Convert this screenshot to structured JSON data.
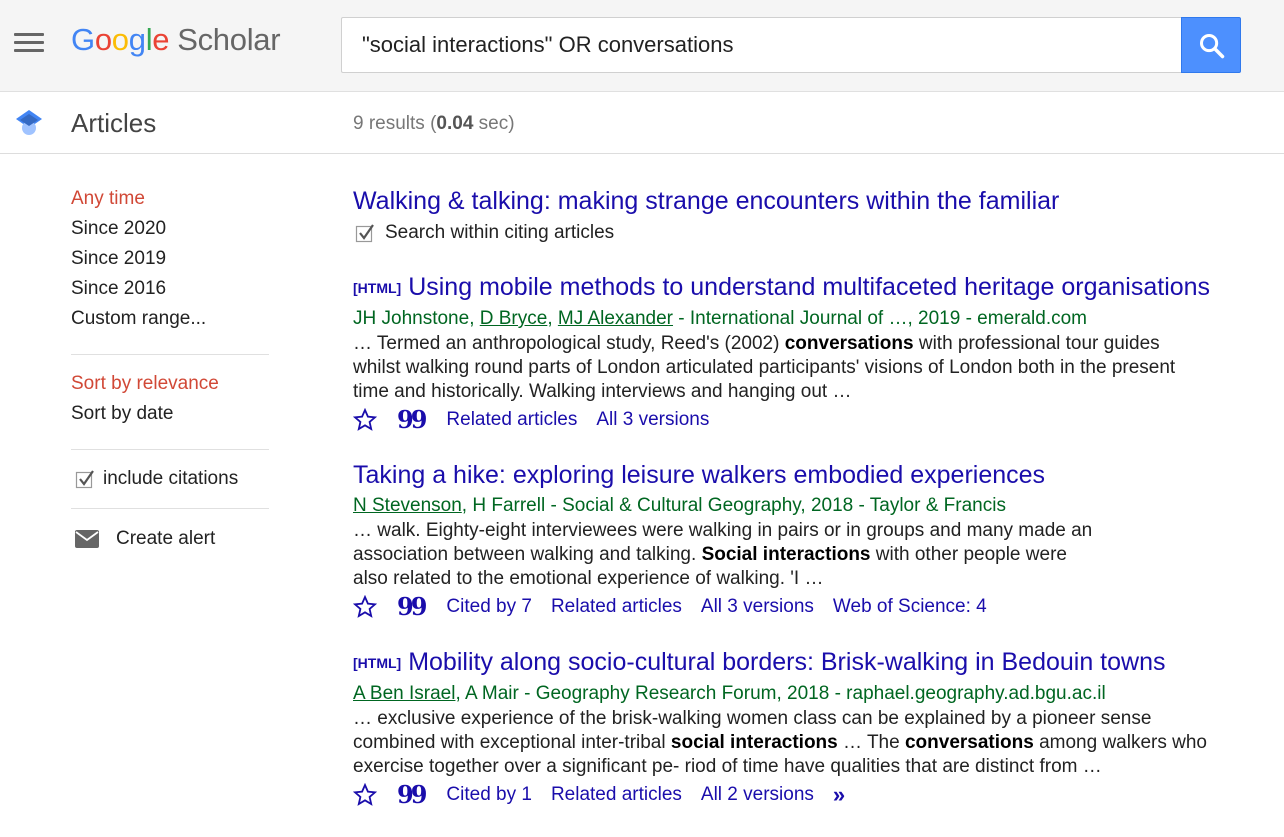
{
  "header": {
    "logo": {
      "google": [
        "G",
        "o",
        "o",
        "g",
        "l",
        "e"
      ],
      "product": "Scholar"
    },
    "search": {
      "value": "\"social interactions\" OR conversations",
      "placeholder": ""
    },
    "menu_icon": "hamburger-menu-icon",
    "search_icon": "search-icon"
  },
  "subheader": {
    "section_icon": "graduation-cap-icon",
    "section_label": "Articles",
    "results_prefix": "9 results (",
    "results_time": "0.04",
    "results_suffix": " sec)"
  },
  "sidebar": {
    "time_filters": [
      "Any time",
      "Since 2020",
      "Since 2019",
      "Since 2016",
      "Custom range..."
    ],
    "time_active_index": 0,
    "sort_options": [
      "Sort by relevance",
      "Sort by date"
    ],
    "sort_active_index": 0,
    "include_citations": {
      "label": "include citations",
      "checked": true
    },
    "create_alert": {
      "label": "Create alert",
      "icon": "envelope-icon"
    }
  },
  "results": {
    "r0": {
      "title": "Walking & talking: making strange encounters within the familiar",
      "citing_label": "Search within citing articles"
    },
    "r1": {
      "tag": "[HTML]",
      "title": "Using mobile methods to understand multifaceted heritage organisations",
      "meta": {
        "a1": "JH Johnstone",
        "sep1": ", ",
        "a2": "D Bryce",
        "sep2": ", ",
        "a3": "MJ Alexander",
        "rest": " - International Journal of …, 2019 - emerald.com"
      },
      "snippet": {
        "p1": "… Termed an anthropological study, Reed's (2002) ",
        "b1": "conversations",
        "p2": " with professional tour guides whilst walking round parts of London articulated participants' visions of London both in the present time and historically. Walking interviews and hanging out …"
      },
      "actions": {
        "related": "Related articles",
        "versions": "All 3 versions"
      }
    },
    "r2": {
      "title": "Taking a hike: exploring leisure walkers embodied experiences",
      "meta": {
        "a1": "N Stevenson",
        "rest": ", H Farrell - Social & Cultural Geography, 2018 - Taylor & Francis"
      },
      "snippet": {
        "p1": "… walk. Eighty-eight interviewees were walking in pairs or in groups and many made an association between walking and talking. ",
        "b1": "Social interactions",
        "p2": " with other people were also related to the emotional experience of walking. 'I …"
      },
      "actions": {
        "cited": "Cited by 7",
        "related": "Related articles",
        "versions": "All 3 versions",
        "wos": "Web of Science: 4"
      }
    },
    "r3": {
      "tag": "[HTML]",
      "title": "Mobility along socio-cultural borders: Brisk-walking in Bedouin towns",
      "meta": {
        "a1": "A Ben Israel",
        "rest": ", A Mair - Geography Research Forum, 2018 - raphael.geography.ad.bgu.ac.il"
      },
      "snippet": {
        "p1": "… exclusive experience of the brisk-walking women class can be explained by a pioneer sense combined with exceptional inter-tribal ",
        "b1": "social interactions",
        "p2": " … The ",
        "b2": "conversations",
        "p3": " among walkers who exercise together over a significant pe- riod of time have qualities that are distinct from …"
      },
      "actions": {
        "cited": "Cited by 1",
        "related": "Related articles",
        "versions": "All 2 versions"
      }
    }
  },
  "icons": {
    "save": "star-icon",
    "cite": "quote-icon",
    "more": "double-chevron-right-icon",
    "check": "checkbox-checked-icon"
  },
  "colors": {
    "link": "#1a0dab",
    "green": "#006621",
    "active": "#d14836",
    "search_button": "#4d90fe"
  }
}
